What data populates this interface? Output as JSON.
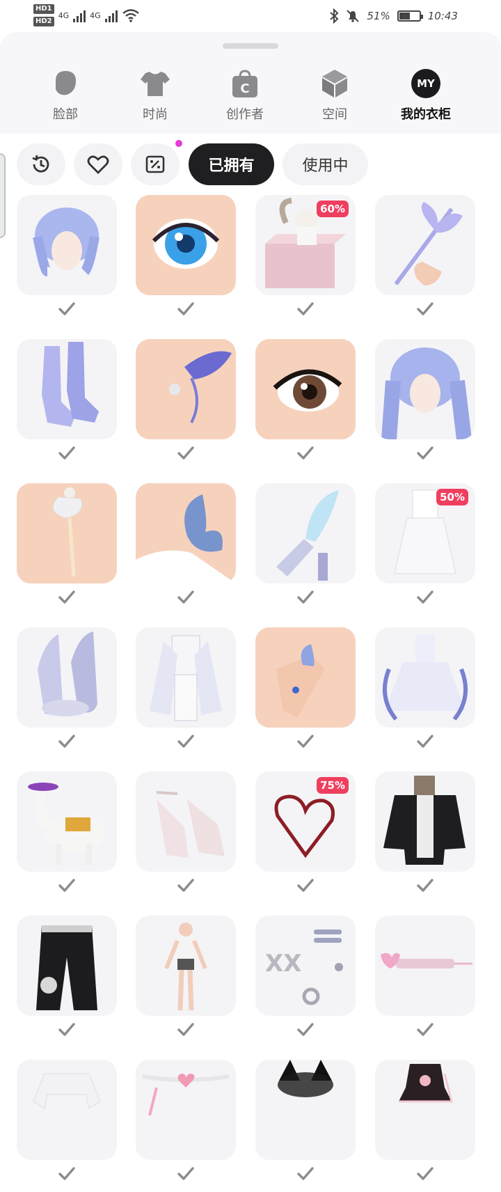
{
  "status": {
    "hd1": "HD1",
    "hd2": "HD2",
    "net1": "4G",
    "net2": "4G",
    "battery": "51%",
    "battery_level": 0.51,
    "time": "10:43"
  },
  "categories": [
    {
      "label": "脸部",
      "icon": "face-icon"
    },
    {
      "label": "时尚",
      "icon": "tshirt-icon"
    },
    {
      "label": "创作者",
      "icon": "creator-bag-icon"
    },
    {
      "label": "空间",
      "icon": "cube-icon"
    },
    {
      "label": "我的衣柜",
      "icon": "my-badge",
      "badge": "MY",
      "active": true
    }
  ],
  "filters": {
    "history_icon": "history-icon",
    "favorite_icon": "heart-icon",
    "coupon_icon": "coupon-icon",
    "owned": "已拥有",
    "in_use": "使用中",
    "active": "owned"
  },
  "items": [
    {
      "name": "blue-hair-short",
      "discount": ""
    },
    {
      "name": "blue-eye",
      "discount": ""
    },
    {
      "name": "cat-box",
      "discount": "60%"
    },
    {
      "name": "butterfly-wand",
      "discount": ""
    },
    {
      "name": "crystal-boots",
      "discount": ""
    },
    {
      "name": "butterfly-earring",
      "discount": ""
    },
    {
      "name": "brown-eye-lashes",
      "discount": ""
    },
    {
      "name": "blue-hair-long",
      "discount": ""
    },
    {
      "name": "pearl-earring",
      "discount": ""
    },
    {
      "name": "shoulder-butterfly",
      "discount": ""
    },
    {
      "name": "ice-wing-leg",
      "discount": ""
    },
    {
      "name": "white-dress",
      "discount": "50%"
    },
    {
      "name": "butterfly-heels",
      "discount": ""
    },
    {
      "name": "white-suit",
      "discount": ""
    },
    {
      "name": "butterfly-ring-hand",
      "discount": ""
    },
    {
      "name": "fairy-gown",
      "discount": ""
    },
    {
      "name": "goose-mount",
      "discount": ""
    },
    {
      "name": "platform-heels",
      "discount": ""
    },
    {
      "name": "heart-scribble",
      "discount": "75%"
    },
    {
      "name": "black-dragon-jacket",
      "discount": ""
    },
    {
      "name": "black-cargo-pants",
      "discount": ""
    },
    {
      "name": "base-body",
      "discount": ""
    },
    {
      "name": "piercing-set",
      "discount": ""
    },
    {
      "name": "pink-syringe",
      "discount": ""
    },
    {
      "name": "white-top",
      "discount": ""
    },
    {
      "name": "pink-heart-choker",
      "discount": ""
    },
    {
      "name": "black-cat-ears",
      "discount": ""
    },
    {
      "name": "black-lace-top",
      "discount": ""
    }
  ],
  "colors": {
    "accent_dark": "#1f1f21",
    "discount_badge": "#ef3f5f",
    "notification_dot": "#e63ad8"
  }
}
